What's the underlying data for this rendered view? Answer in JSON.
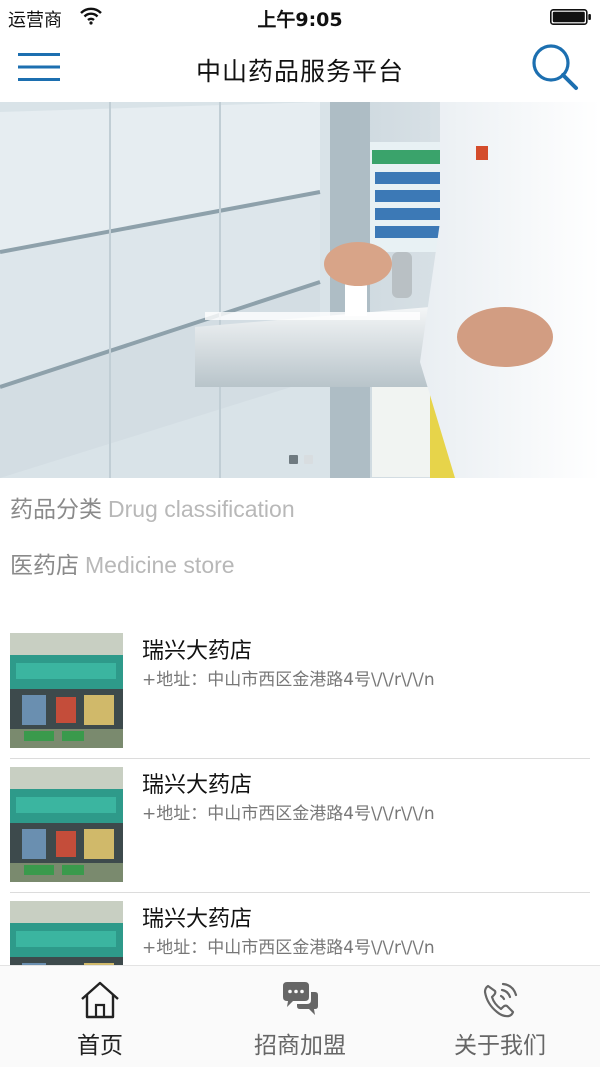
{
  "status_bar": {
    "carrier": "运营商",
    "time": "上午9:05"
  },
  "nav": {
    "title": "中山药品服务平台",
    "menu_icon": "hamburger-menu-icon",
    "search_icon": "search-icon"
  },
  "banner": {
    "slide_count": 2,
    "active_slide": 1
  },
  "categories": [
    {
      "label_cn": "药品分类",
      "label_en": "Drug classification"
    },
    {
      "label_cn": "医药店",
      "label_en": "Medicine store"
    }
  ],
  "stores": [
    {
      "name": "瑞兴大药店",
      "address": "+地址：中山市西区金港路4号\\/\\/r\\/\\/n"
    },
    {
      "name": "瑞兴大药店",
      "address": "+地址：中山市西区金港路4号\\/\\/r\\/\\/n"
    },
    {
      "name": "瑞兴大药店",
      "address": "+地址：中山市西区金港路4号\\/\\/r\\/\\/n"
    }
  ],
  "tabs": [
    {
      "label": "首页",
      "icon": "home-icon",
      "active": true
    },
    {
      "label": "招商加盟",
      "icon": "chat-bubbles-icon",
      "active": false
    },
    {
      "label": "关于我们",
      "icon": "phone-icon",
      "active": false
    }
  ],
  "colors": {
    "accent": "#1c6fb0",
    "category_text": "#8a8a8a",
    "category_en_text": "#b8b8b8"
  }
}
